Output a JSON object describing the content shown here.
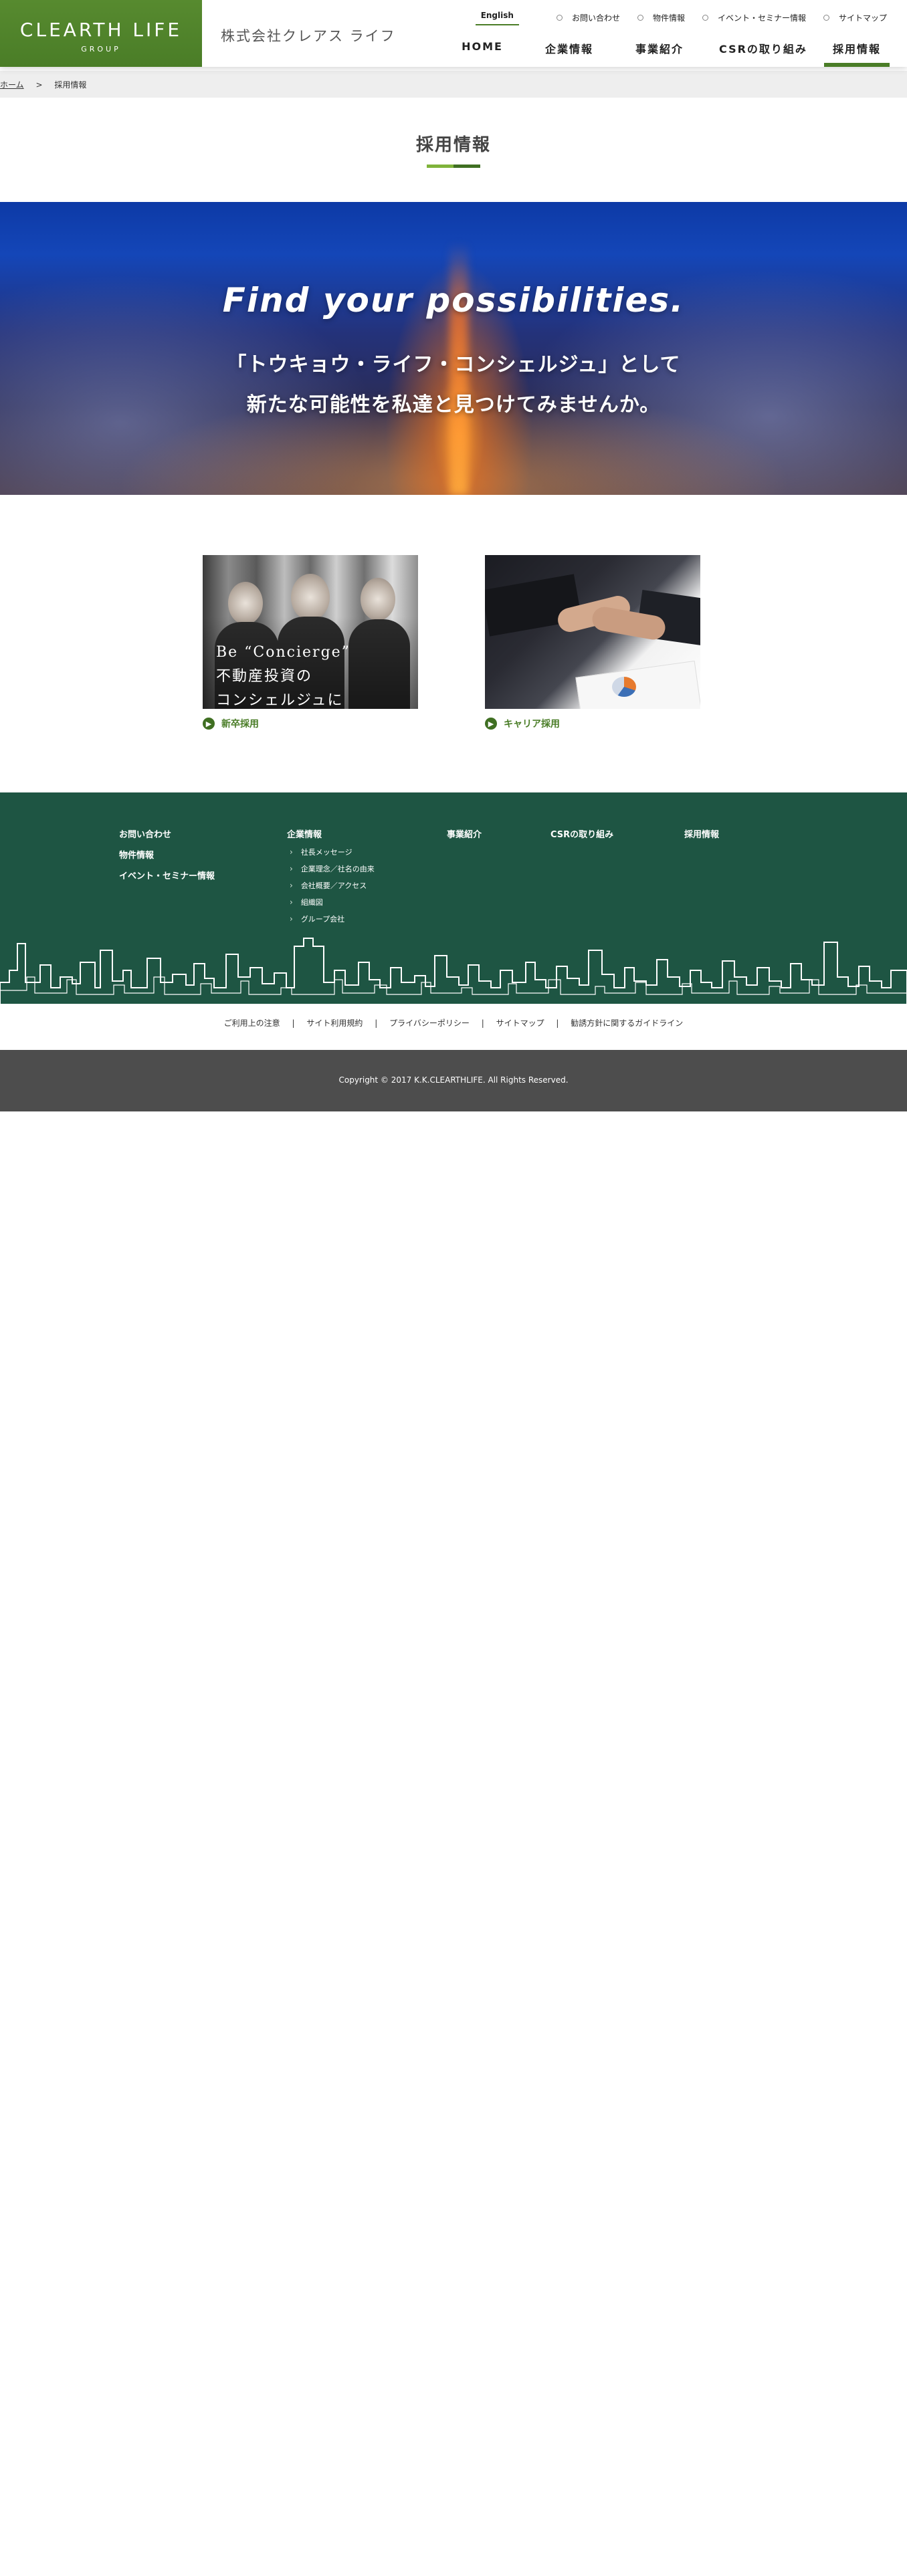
{
  "header": {
    "logo_main": "CLEARTH LIFE",
    "logo_sub": "GROUP",
    "company_name": "株式会社クレアス ライフ",
    "util_nav": {
      "english": "English",
      "items": [
        "お問い合わせ",
        "物件情報",
        "イベント・セミナー情報",
        "サイトマップ"
      ]
    },
    "main_nav": [
      "HOME",
      "企業情報",
      "事業紹介",
      "CSRの取り組み",
      "採用情報"
    ],
    "active_nav": "採用情報",
    "accent_color": "#4a7d27"
  },
  "breadcrumb": {
    "home": "ホーム",
    "separator": ">",
    "current": "採用情報"
  },
  "page_title": "採用情報",
  "hero": {
    "heading": "Find your possibilities.",
    "line1": "「トウキョウ・ライフ・コンシェルジュ」として",
    "line2": "新たな可能性を私達と見つけてみませんか。"
  },
  "cards": [
    {
      "label": "新卒採用",
      "image_caption_line1": "Be “Concierge”",
      "image_caption_line2": "不動産投資の",
      "image_caption_line3": "コンシェルジュに"
    },
    {
      "label": "キャリア採用"
    }
  ],
  "footer": {
    "col1": [
      "お問い合わせ",
      "物件情報",
      "イベント・セミナー情報"
    ],
    "col2_title": "企業情報",
    "col2_sub": [
      "社長メッセージ",
      "企業理念／社名の由来",
      "会社概要／アクセス",
      "組織図",
      "グループ会社"
    ],
    "col3": "事業紹介",
    "col4": "CSRの取り組み",
    "col5": "採用情報",
    "bg_color": "#1e5543"
  },
  "footer_links": [
    "ご利用上の注意",
    "サイト利用規約",
    "プライバシーポリシー",
    "サイトマップ",
    "勧誘方針に関するガイドライン"
  ],
  "footer_links_separator": "|",
  "copyright": "Copyright © 2017 K.K.CLEARTHLIFE. All Rights Reserved."
}
